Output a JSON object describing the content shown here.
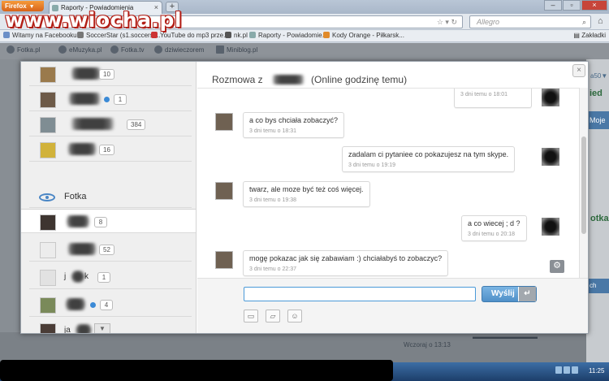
{
  "watermark": "www.wiocha.pl",
  "browser": {
    "menu_label": "Firefox",
    "tab_title": "Raporty - Powiadomienia",
    "newtab": "+",
    "url_text": "",
    "search_placeholder": "Allegro",
    "bookmarks": [
      "Witamy na Facebooku...",
      "SoccerStar (s1.soccerst...",
      "YouTube do mp3 prze...",
      "nk.pl",
      "Raporty - Powiadomie...",
      "Kody Orange - Piłkarsk..."
    ],
    "bookmarks_right": "Zakładki"
  },
  "site_nav": [
    "Fotka.pl",
    "eMuzyka.pl",
    "Fotka.tv",
    "dziwieczorem",
    "Miniblog.pl"
  ],
  "right_fragments": {
    "link": "a50▼",
    "label1": "ied",
    "button1": "Moje",
    "label2": "otka",
    "button2": "ch"
  },
  "bottom": {
    "date": "Wczoraj o 13:13"
  },
  "contacts": [
    {
      "count": "10",
      "online": false
    },
    {
      "count": "1",
      "online": true
    },
    {
      "count": "384",
      "online": false
    },
    {
      "count": "16",
      "online": false
    },
    {
      "count": "8",
      "online": false
    },
    {
      "count": "52",
      "online": false
    },
    {
      "name": "j",
      "name_end": "k",
      "count": "1",
      "online": false
    },
    {
      "count": "4",
      "online": true
    },
    {
      "name": "ja",
      "count": "",
      "online": false
    }
  ],
  "fotka_item": "Fotka",
  "chat": {
    "title_prefix": "Rozmowa z",
    "title_suffix": "(Online godzinę temu)",
    "close": "×",
    "messages": [
      {
        "from": "me",
        "text": "",
        "date": "3 dni temu o 18:01"
      },
      {
        "from": "them",
        "text": "a co bys chciała zobaczyć?",
        "date": "3 dni temu o 18:31"
      },
      {
        "from": "me",
        "text": "zadalam ci pytaniee co pokazujesz na tym skype.",
        "date": "3 dni temu o 19:19"
      },
      {
        "from": "them",
        "text": "twarz, ale moze być też coś więcej.",
        "date": "3 dni temu o 19:38"
      },
      {
        "from": "me",
        "text": "a co wiecej ; d ?",
        "date": "3 dni temu o 20:18"
      },
      {
        "from": "them",
        "text": "mogę pokazac jak się zabawiam :) chciałabyś to zobaczyc?",
        "date": "3 dni temu o 22:37"
      }
    ],
    "send_label": "Wyślij",
    "enter_symbol": "↵",
    "input_value": ""
  },
  "icons": [
    "image-icon",
    "chat-bubble-icon",
    "smiley-icon",
    "gear-icon"
  ],
  "taskbar": {
    "clock": "11:25"
  }
}
